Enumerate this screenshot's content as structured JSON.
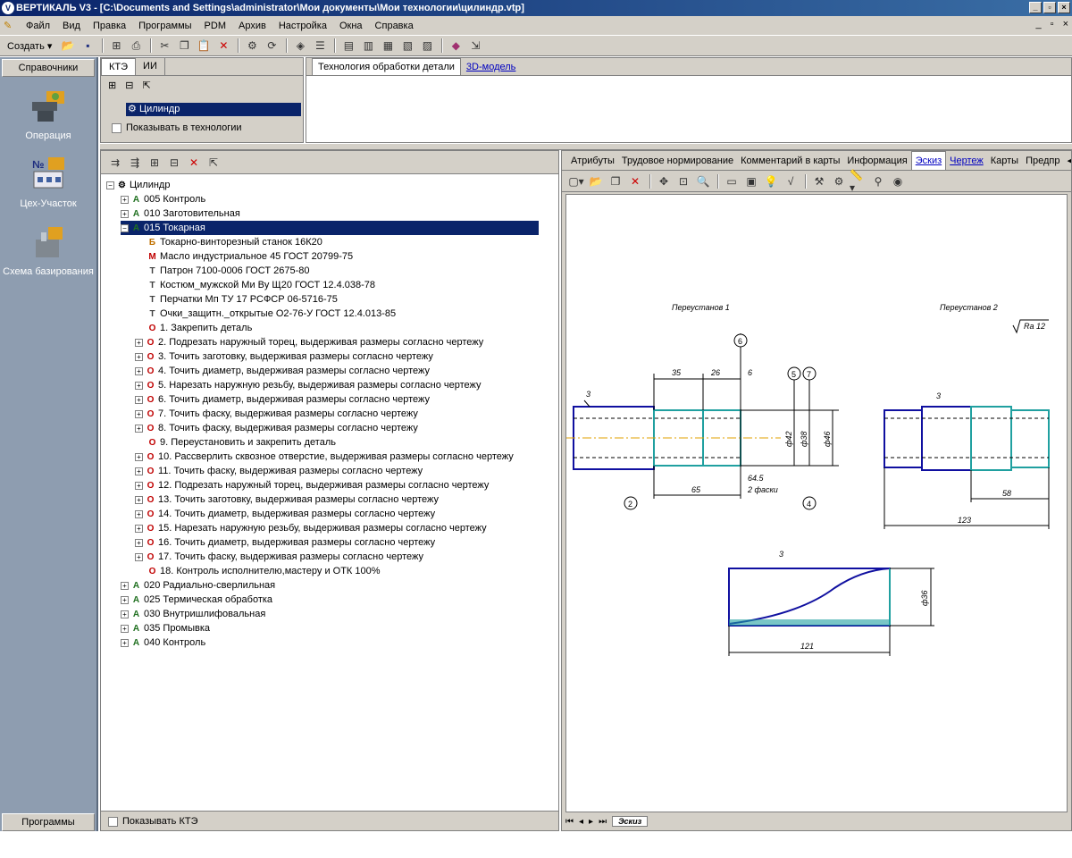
{
  "window": {
    "title": "ВЕРТИКАЛЬ V3 - [C:\\Documents and Settings\\administrator\\Мои документы\\Мои технологии\\цилиндр.vtp]"
  },
  "menu": [
    "Файл",
    "Вид",
    "Правка",
    "Программы",
    "PDM",
    "Архив",
    "Настройка",
    "Окна",
    "Справка"
  ],
  "toolbar": {
    "create_label": "Создать"
  },
  "left_panel": {
    "header": "Справочники",
    "items": [
      {
        "label": "Операция",
        "icon": "operation-icon"
      },
      {
        "label": "Цех-Участок",
        "icon": "workshop-icon"
      },
      {
        "label": "Схема базирования",
        "icon": "basing-scheme-icon"
      }
    ],
    "footer": "Программы"
  },
  "kte": {
    "tabs": [
      "КТЭ",
      "ИИ"
    ],
    "root": "Цилиндр",
    "show_in_tech": "Показывать в технологии"
  },
  "tech_tabs": [
    "Технология обработки детали",
    "3D-модель"
  ],
  "tree": {
    "root": "Цилиндр",
    "rows": [
      {
        "text": "005  Контроль",
        "icon": "A",
        "level": 1,
        "exp": "+"
      },
      {
        "text": "010  Заготовительная",
        "icon": "A",
        "level": 1,
        "exp": "+"
      },
      {
        "text": "015  Токарная",
        "icon": "A",
        "level": 1,
        "exp": "-",
        "selected": true
      },
      {
        "text": "Токарно-винторезный станок 16К20",
        "icon": "Б",
        "level": 2
      },
      {
        "text": "Масло индустриальное 45 ГОСТ 20799-75",
        "icon": "М",
        "level": 2
      },
      {
        "text": "Патрон 7100-0006 ГОСТ 2675-80",
        "icon": "Т",
        "level": 2
      },
      {
        "text": "Костюм_мужской Ми Ву Щ20 ГОСТ 12.4.038-78",
        "icon": "Т",
        "level": 2
      },
      {
        "text": "Перчатки Мп ТУ 17 РСФСР 06-5716-75",
        "icon": "Т",
        "level": 2
      },
      {
        "text": "Очки_защитн._открытые О2-76-У ГОСТ 12.4.013-85",
        "icon": "Т",
        "level": 2
      },
      {
        "text": "1. Закрепить деталь",
        "icon": "О",
        "level": 2
      },
      {
        "text": "2. Подрезать наружный торец, выдерживая размеры согласно чертежу",
        "icon": "О",
        "level": 2,
        "exp": "+"
      },
      {
        "text": "3. Точить заготовку, выдерживая размеры согласно чертежу",
        "icon": "О",
        "level": 2,
        "exp": "+"
      },
      {
        "text": "4. Точить диаметр, выдерживая размеры согласно чертежу",
        "icon": "О",
        "level": 2,
        "exp": "+"
      },
      {
        "text": "5. Нарезать наружную резьбу, выдерживая размеры согласно чертежу",
        "icon": "О",
        "level": 2,
        "exp": "+"
      },
      {
        "text": "6. Точить диаметр, выдерживая размеры согласно чертежу",
        "icon": "О",
        "level": 2,
        "exp": "+"
      },
      {
        "text": "7. Точить фаску, выдерживая размеры согласно чертежу",
        "icon": "О",
        "level": 2,
        "exp": "+"
      },
      {
        "text": "8. Точить фаску, выдерживая размеры согласно чертежу",
        "icon": "О",
        "level": 2,
        "exp": "+"
      },
      {
        "text": "9. Переустановить и закрепить деталь",
        "icon": "О",
        "level": 2
      },
      {
        "text": "10. Рассверлить сквозное отверстие, выдерживая размеры согласно чертежу",
        "icon": "О",
        "level": 2,
        "exp": "+"
      },
      {
        "text": "11. Точить фаску, выдерживая размеры согласно чертежу",
        "icon": "О",
        "level": 2,
        "exp": "+"
      },
      {
        "text": "12. Подрезать наружный торец, выдерживая размеры согласно чертежу",
        "icon": "О",
        "level": 2,
        "exp": "+"
      },
      {
        "text": "13. Точить заготовку, выдерживая размеры согласно чертежу",
        "icon": "О",
        "level": 2,
        "exp": "+"
      },
      {
        "text": "14. Точить диаметр, выдерживая размеры согласно чертежу",
        "icon": "О",
        "level": 2,
        "exp": "+"
      },
      {
        "text": "15. Нарезать наружную резьбу, выдерживая размеры согласно чертежу",
        "icon": "О",
        "level": 2,
        "exp": "+"
      },
      {
        "text": "16. Точить диаметр, выдерживая размеры согласно чертежу",
        "icon": "О",
        "level": 2,
        "exp": "+"
      },
      {
        "text": "17. Точить фаску, выдерживая размеры согласно чертежу",
        "icon": "О",
        "level": 2,
        "exp": "+"
      },
      {
        "text": "18. Контроль исполнителю,мастеру и ОТК 100%",
        "icon": "О",
        "level": 2
      },
      {
        "text": "020  Радиально-сверлильная",
        "icon": "A",
        "level": 1,
        "exp": "+"
      },
      {
        "text": "025  Термическая обработка",
        "icon": "A",
        "level": 1,
        "exp": "+"
      },
      {
        "text": "030  Внутришлифовальная",
        "icon": "A",
        "level": 1,
        "exp": "+"
      },
      {
        "text": "035  Промывка",
        "icon": "A",
        "level": 1,
        "exp": "+"
      },
      {
        "text": "040  Контроль",
        "icon": "A",
        "level": 1,
        "exp": "+"
      }
    ],
    "footer": "Показывать КТЭ"
  },
  "draw_tabs": [
    "Атрибуты",
    "Трудовое нормирование",
    "Комментарий в карты",
    "Информация",
    "Эскиз",
    "Чертеж",
    "Карты",
    "Предпр"
  ],
  "drawing": {
    "setup1": "Переустанов 1",
    "setup2": "Переустанов 2",
    "roughness": "Ra 12",
    "dims": [
      "35",
      "26",
      "6",
      "65",
      "64.5",
      "2 фаски",
      "58",
      "123",
      "121",
      "ф42",
      "ф38",
      "ф46",
      "ф36"
    ],
    "markers": [
      "6",
      "5",
      "7",
      "2",
      "4",
      "3"
    ],
    "sheet_tab": "Эскиз"
  }
}
